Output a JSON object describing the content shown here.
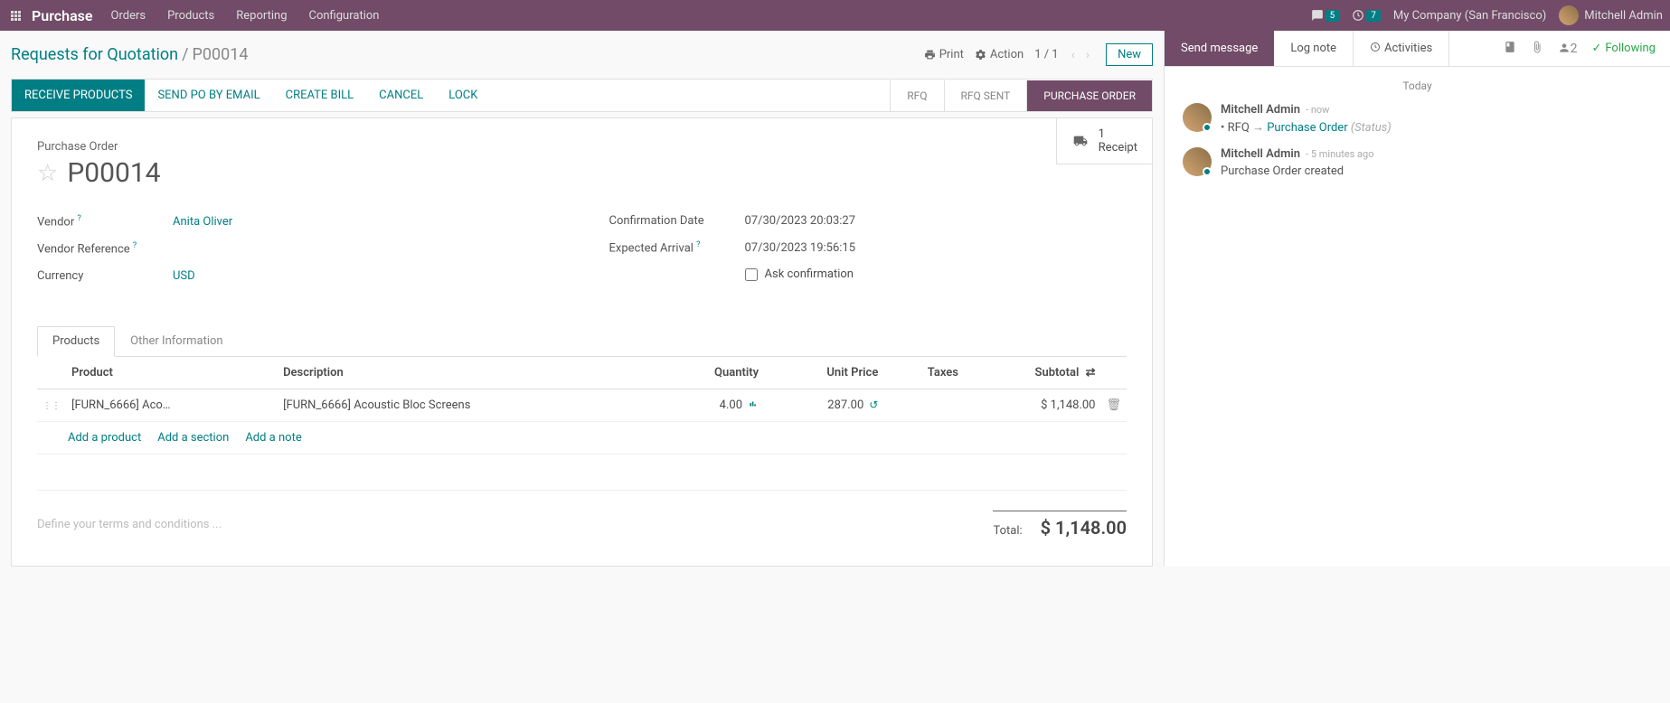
{
  "topbar": {
    "app": "Purchase",
    "menu": [
      "Orders",
      "Products",
      "Reporting",
      "Configuration"
    ],
    "chat_count": "5",
    "clock_count": "7",
    "company": "My Company (San Francisco)",
    "user": "Mitchell Admin"
  },
  "breadcrumb": {
    "root": "Requests for Quotation",
    "current": "P00014",
    "print": "Print",
    "action": "Action",
    "pager": "1 / 1",
    "new_btn": "New"
  },
  "actions": {
    "receive": "RECEIVE PRODUCTS",
    "send_email": "SEND PO BY EMAIL",
    "create_bill": "CREATE BILL",
    "cancel": "CANCEL",
    "lock": "LOCK"
  },
  "status": {
    "rfq": "RFQ",
    "rfq_sent": "RFQ SENT",
    "po": "PURCHASE ORDER"
  },
  "receipt": {
    "count": "1",
    "label": "Receipt"
  },
  "record": {
    "title_label": "Purchase Order",
    "name": "P00014",
    "vendor_label": "Vendor",
    "vendor": "Anita Oliver",
    "vendor_ref_label": "Vendor Reference",
    "currency_label": "Currency",
    "currency": "USD",
    "confirm_date_label": "Confirmation Date",
    "confirm_date": "07/30/2023 20:03:27",
    "expected_label": "Expected Arrival",
    "expected": "07/30/2023 19:56:15",
    "ask_confirm": "Ask confirmation"
  },
  "tabs": {
    "products": "Products",
    "other": "Other Information"
  },
  "table": {
    "headers": {
      "product": "Product",
      "description": "Description",
      "quantity": "Quantity",
      "unit_price": "Unit Price",
      "taxes": "Taxes",
      "subtotal": "Subtotal"
    },
    "rows": [
      {
        "product": "[FURN_6666] Acoustic …",
        "description": "[FURN_6666] Acoustic Bloc Screens",
        "quantity": "4.00",
        "unit_price": "287.00",
        "taxes": "",
        "subtotal": "$ 1,148.00"
      }
    ],
    "add_product": "Add a product",
    "add_section": "Add a section",
    "add_note": "Add a note"
  },
  "footer": {
    "terms_placeholder": "Define your terms and conditions ...",
    "total_label": "Total:",
    "total_value": "$ 1,148.00"
  },
  "chatter": {
    "send": "Send message",
    "log": "Log note",
    "activities": "Activities",
    "follower_count": "2",
    "following": "Following",
    "today": "Today",
    "messages": [
      {
        "author": "Mitchell Admin",
        "time": "- now",
        "type": "tracking",
        "field": "RFQ",
        "new_value": "Purchase Order",
        "status": "(Status)"
      },
      {
        "author": "Mitchell Admin",
        "time": "- 5 minutes ago",
        "type": "text",
        "body": "Purchase Order created"
      }
    ]
  }
}
